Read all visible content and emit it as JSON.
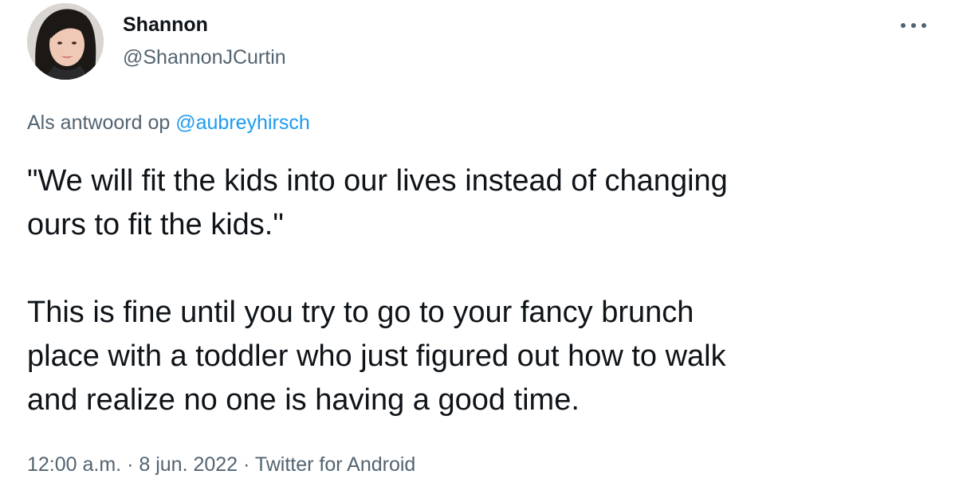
{
  "author": {
    "display_name": "Shannon",
    "handle": "@ShannonJCurtin",
    "avatar_icon": "profile-photo"
  },
  "menu": {
    "icon": "more-horizontal-icon"
  },
  "reply": {
    "prefix": "Als antwoord op",
    "mention": "@aubreyhirsch"
  },
  "tweet": {
    "text": "\"We will fit the kids into our lives instead of changing\nours to fit the kids.\"\n\nThis is fine until you try to go to your fancy brunch\nplace with a toddler who just figured out how to walk\nand realize no one is having a good time."
  },
  "meta": {
    "time": "12:00 a.m.",
    "separator": " · ",
    "date": "8 jun. 2022",
    "source": "Twitter for Android"
  },
  "colors": {
    "text_primary": "#0f1419",
    "text_secondary": "#536471",
    "link": "#1d9bf0"
  }
}
